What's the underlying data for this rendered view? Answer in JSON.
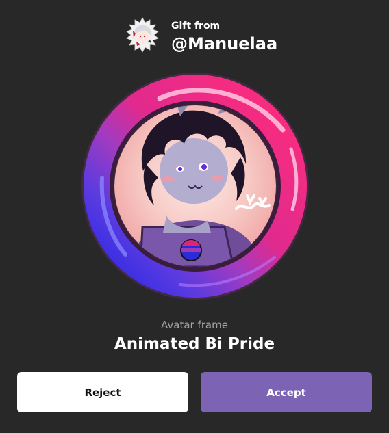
{
  "gift": {
    "label": "Gift from",
    "sender": "@Manuelaa"
  },
  "item": {
    "type_label": "Avatar frame",
    "name": "Animated Bi Pride"
  },
  "actions": {
    "reject_label": "Reject",
    "accept_label": "Accept"
  },
  "colors": {
    "background": "#282828",
    "accent": "#7c63b4",
    "frame_pink": "#e8267a",
    "frame_purple": "#9b3bb5",
    "frame_blue": "#2b2bd8"
  }
}
